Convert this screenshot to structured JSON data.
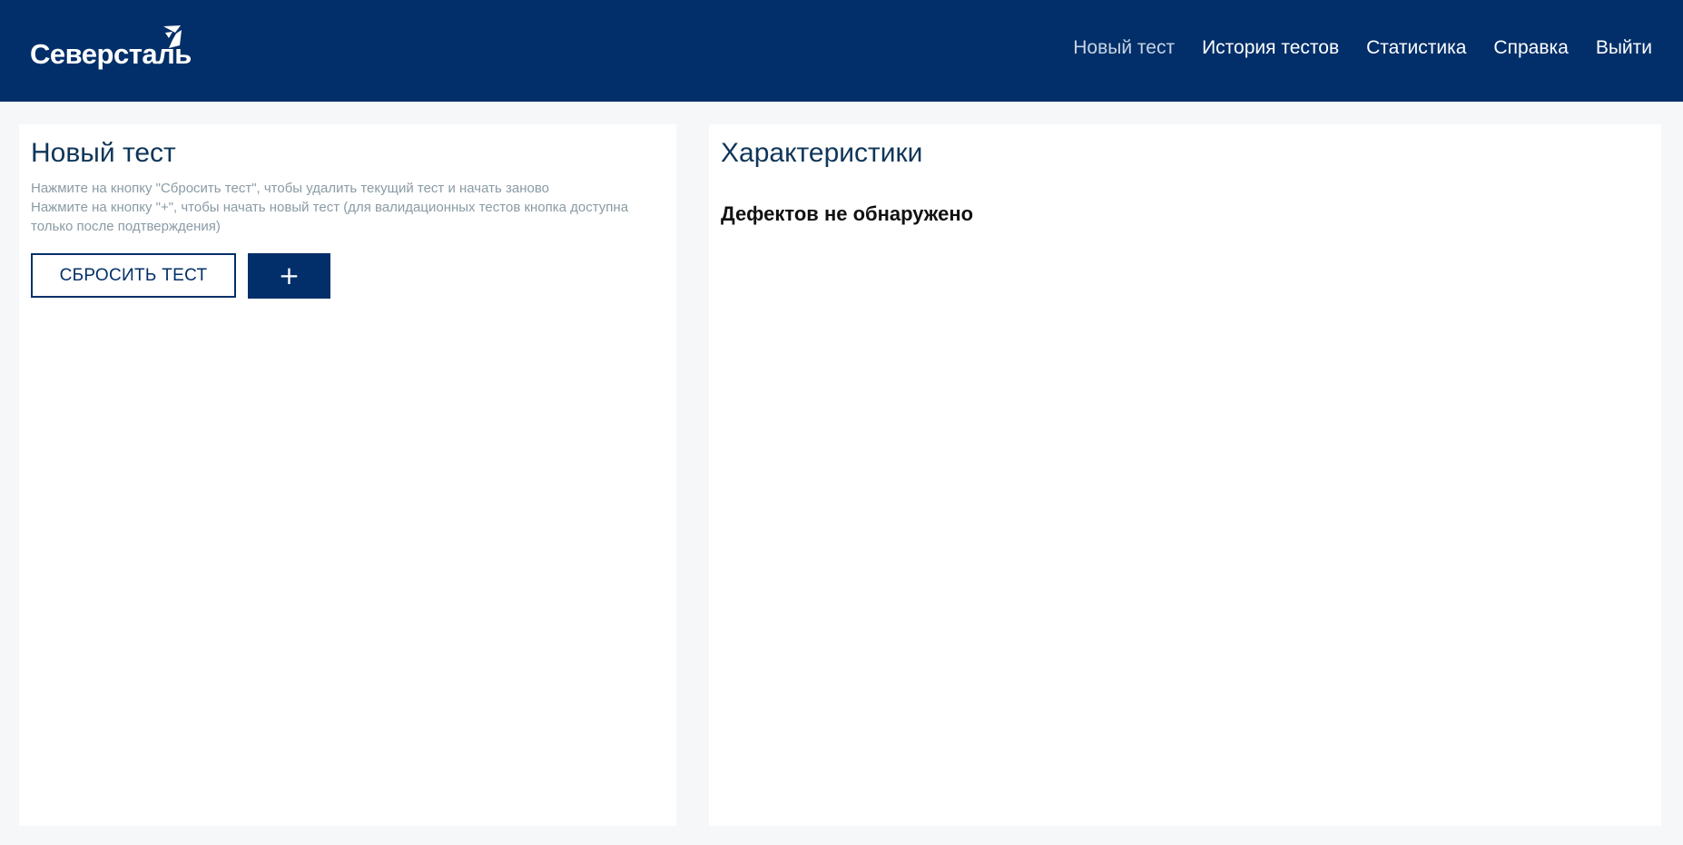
{
  "header": {
    "logo_text": "Северсталь",
    "logo_icon": "severstal-mark-icon",
    "nav": [
      {
        "label": "Новый тест",
        "active": true
      },
      {
        "label": "История тестов",
        "active": false
      },
      {
        "label": "Статистика",
        "active": false
      },
      {
        "label": "Справка",
        "active": false
      },
      {
        "label": "Выйти",
        "active": false
      }
    ]
  },
  "new_test": {
    "title": "Новый тест",
    "hints": [
      "Нажмите на кнопку \"Сбросить тест\", чтобы удалить текущий тест и начать заново",
      "Нажмите на кнопку \"+\", чтобы начать новый тест (для валидационных тестов кнопка доступна",
      "только после подтверждения)"
    ],
    "reset_button": "СБРОСИТЬ ТЕСТ",
    "add_button": "+"
  },
  "characteristics": {
    "title": "Характеристики",
    "status": "Дефектов не обнаружено"
  },
  "colors": {
    "brand": "#022f69",
    "background": "#f5f7f8",
    "hint_text": "#8a9ba5",
    "title_text": "#0f3659",
    "nav_active": "#c7d4e4"
  }
}
